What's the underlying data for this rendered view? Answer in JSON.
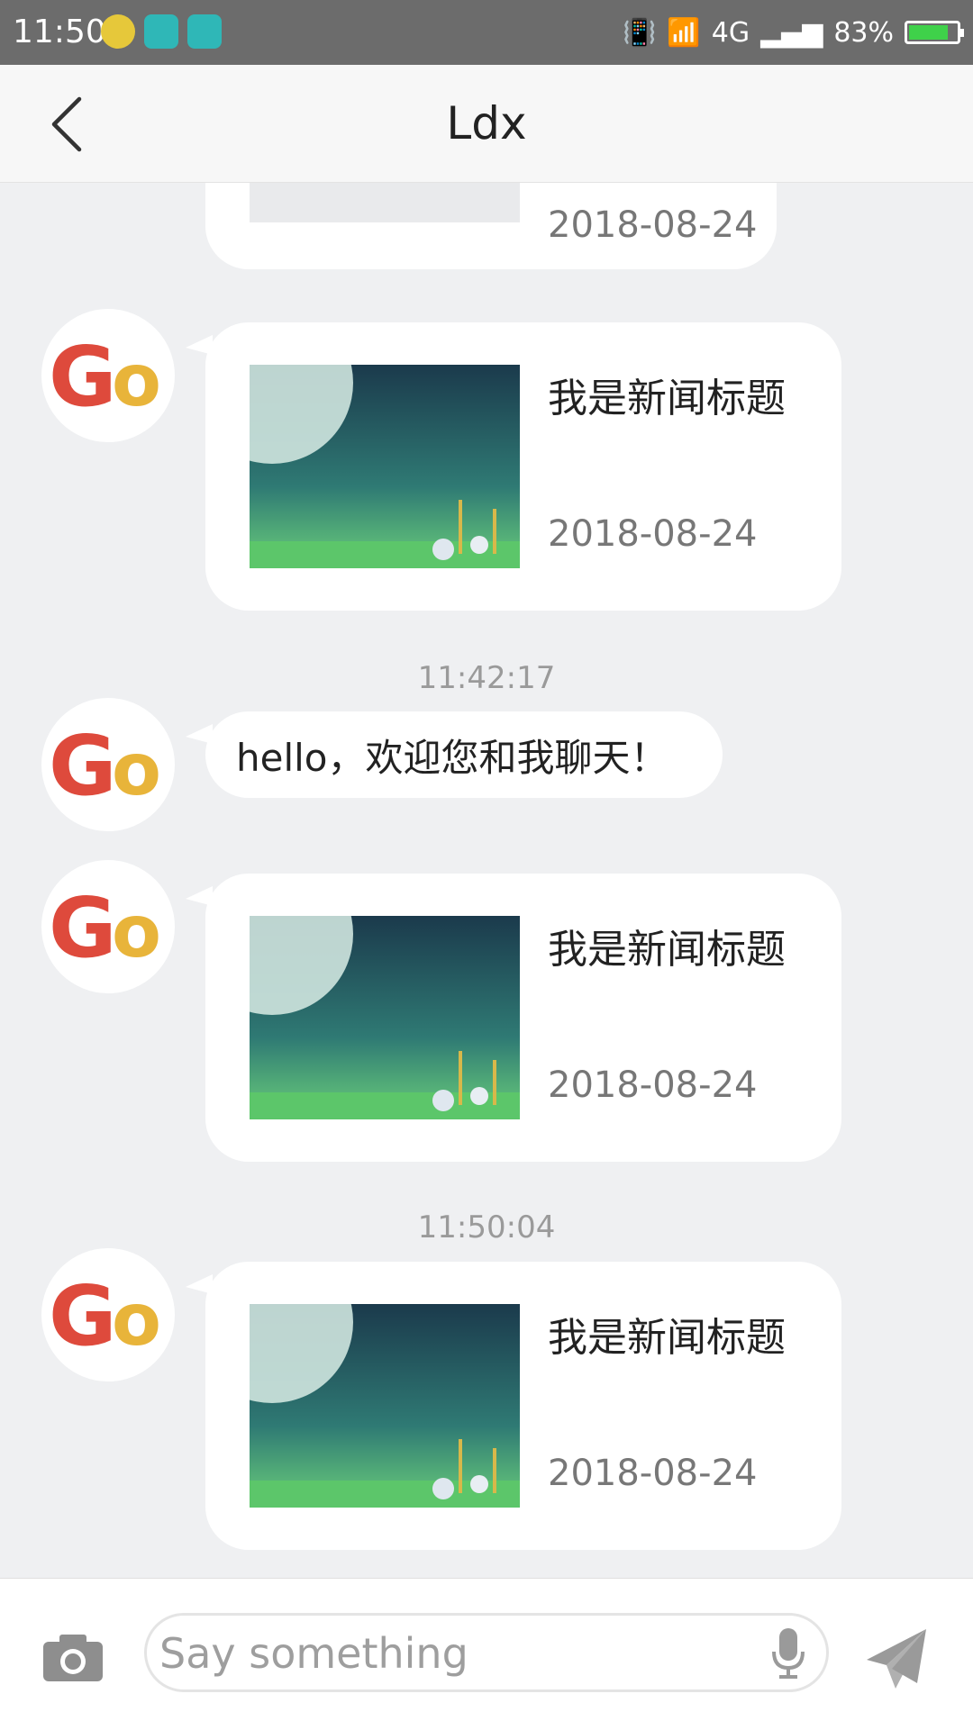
{
  "status_bar": {
    "time": "11:50",
    "network": "4G",
    "battery": "83%",
    "battery_level": 0.83
  },
  "header": {
    "title": "Ldx"
  },
  "colors": {
    "status_bar_bg": "#6c6c6c",
    "chat_bg": "#eff0f2",
    "bubble_bg": "#ffffff",
    "battery_green": "#3fd14a"
  },
  "messages": {
    "partial_card": {
      "date": "2018-08-24"
    },
    "card1": {
      "title": "我是新闻标题",
      "date": "2018-08-24"
    },
    "timestamp1": "11:42:17",
    "text1": "hello，欢迎您和我聊天！",
    "card2": {
      "title": "我是新闻标题",
      "date": "2018-08-24"
    },
    "timestamp2": "11:50:04",
    "card3": {
      "title": "我是新闻标题",
      "date": "2018-08-24"
    }
  },
  "avatar_text": "Go",
  "input": {
    "placeholder": "Say something"
  },
  "icons": {
    "back": "back-arrow-icon",
    "camera": "camera-icon",
    "mic": "microphone-icon",
    "send": "send-icon"
  }
}
